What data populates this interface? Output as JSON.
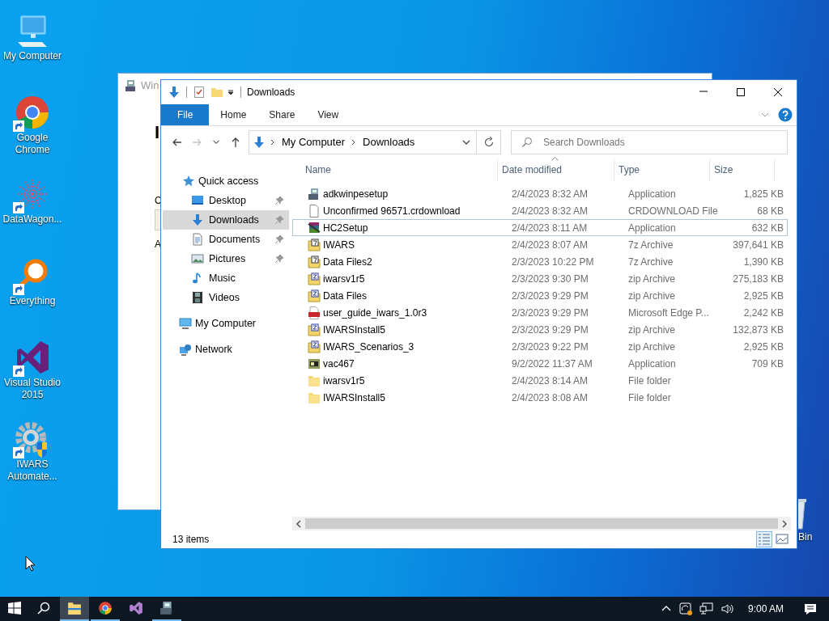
{
  "desktop_icons": [
    {
      "label": "My Computer",
      "kind": "computer",
      "shortcut": false
    },
    {
      "label": "Google Chrome",
      "kind": "chrome",
      "shortcut": true
    },
    {
      "label": "DataWagon...",
      "kind": "starburst",
      "shortcut": true
    },
    {
      "label": "Everything",
      "kind": "magnifier",
      "shortcut": true
    },
    {
      "label": "Visual Studio 2015",
      "kind": "vs",
      "shortcut": true
    },
    {
      "label": "IWARS Automate...",
      "kind": "gear",
      "shortcut": true
    }
  ],
  "recycle_bin": {
    "label": "Bin"
  },
  "background_window": {
    "title": "Win",
    "heading": "I",
    "label_1": "C",
    "label_2": "A"
  },
  "explorer": {
    "title": "Downloads",
    "ribbon_tabs": [
      {
        "label": "File",
        "selected": true
      },
      {
        "label": "Home",
        "selected": false
      },
      {
        "label": "Share",
        "selected": false
      },
      {
        "label": "View",
        "selected": false
      }
    ],
    "address": [
      "My Computer",
      "Downloads"
    ],
    "search": {
      "placeholder": "Search Downloads"
    },
    "nav": [
      {
        "label": "Quick access",
        "kind": "star",
        "selected": false,
        "children": [
          {
            "label": "Desktop",
            "kind": "desktop",
            "pinned": true,
            "selected": false
          },
          {
            "label": "Downloads",
            "kind": "download",
            "pinned": true,
            "selected": true
          },
          {
            "label": "Documents",
            "kind": "document",
            "pinned": true,
            "selected": false
          },
          {
            "label": "Pictures",
            "kind": "pictures",
            "pinned": true,
            "selected": false
          },
          {
            "label": "Music",
            "kind": "music",
            "pinned": false,
            "selected": false
          },
          {
            "label": "Videos",
            "kind": "videos",
            "pinned": false,
            "selected": false
          }
        ]
      },
      {
        "label": "My Computer",
        "kind": "computer",
        "selected": false
      },
      {
        "label": "Network",
        "kind": "network",
        "selected": false
      }
    ],
    "columns": [
      {
        "label": "Name",
        "sorted": false
      },
      {
        "label": "Date modified",
        "sorted": true
      },
      {
        "label": "Type",
        "sorted": false
      },
      {
        "label": "Size",
        "sorted": false
      }
    ],
    "files": [
      {
        "name": "adkwinpesetup",
        "date": "2/4/2023 8:32 AM",
        "type": "Application",
        "size": "1,825 KB",
        "kind": "installer",
        "selected": false
      },
      {
        "name": "Unconfirmed 96571.crdownload",
        "date": "2/4/2023 8:32 AM",
        "type": "CRDOWNLOAD File",
        "size": "68 KB",
        "kind": "blank",
        "selected": false
      },
      {
        "name": "HC2Setup",
        "date": "2/4/2023 8:11 AM",
        "type": "Application",
        "size": "632 KB",
        "kind": "packed",
        "selected": true
      },
      {
        "name": "IWARS",
        "date": "2/4/2023 8:07 AM",
        "type": "7z Archive",
        "size": "397,641 KB",
        "kind": "sevenzip",
        "selected": false
      },
      {
        "name": "Data Files2",
        "date": "2/3/2023 10:22 PM",
        "type": "7z Archive",
        "size": "1,390 KB",
        "kind": "sevenzip",
        "selected": false
      },
      {
        "name": "iwarsv1r5",
        "date": "2/3/2023 9:30 PM",
        "type": "zip Archive",
        "size": "275,183 KB",
        "kind": "zip",
        "selected": false
      },
      {
        "name": "Data Files",
        "date": "2/3/2023 9:29 PM",
        "type": "zip Archive",
        "size": "2,925 KB",
        "kind": "zip",
        "selected": false
      },
      {
        "name": "user_guide_iwars_1.0r3",
        "date": "2/3/2023 9:29 PM",
        "type": "Microsoft Edge P...",
        "size": "2,242 KB",
        "kind": "pdf",
        "selected": false
      },
      {
        "name": "IWARSInstall5",
        "date": "2/3/2023 9:29 PM",
        "type": "zip Archive",
        "size": "132,873 KB",
        "kind": "zip",
        "selected": false
      },
      {
        "name": "IWARS_Scenarios_3",
        "date": "2/3/2023 9:22 PM",
        "type": "zip Archive",
        "size": "2,925 KB",
        "kind": "zip",
        "selected": false
      },
      {
        "name": "vac467",
        "date": "9/2/2022 11:37 AM",
        "type": "Application",
        "size": "709 KB",
        "kind": "app",
        "selected": false
      },
      {
        "name": "iwarsv1r5",
        "date": "2/4/2023 8:14 AM",
        "type": "File folder",
        "kind": "folder",
        "selected": false
      },
      {
        "name": "IWARSInstall5",
        "date": "2/4/2023 8:08 AM",
        "type": "File folder",
        "kind": "folder",
        "selected": false
      }
    ],
    "status": "13 items",
    "views": [
      {
        "kind": "details",
        "selected": true
      },
      {
        "kind": "tiles",
        "selected": false
      }
    ]
  },
  "taskbar": {
    "apps": [
      {
        "kind": "explorer",
        "open": true,
        "active": true
      },
      {
        "kind": "chrome",
        "open": true,
        "active": false
      },
      {
        "kind": "vs",
        "open": false,
        "active": false
      },
      {
        "kind": "installer",
        "open": true,
        "active": false
      }
    ],
    "time": "9:00 AM"
  }
}
